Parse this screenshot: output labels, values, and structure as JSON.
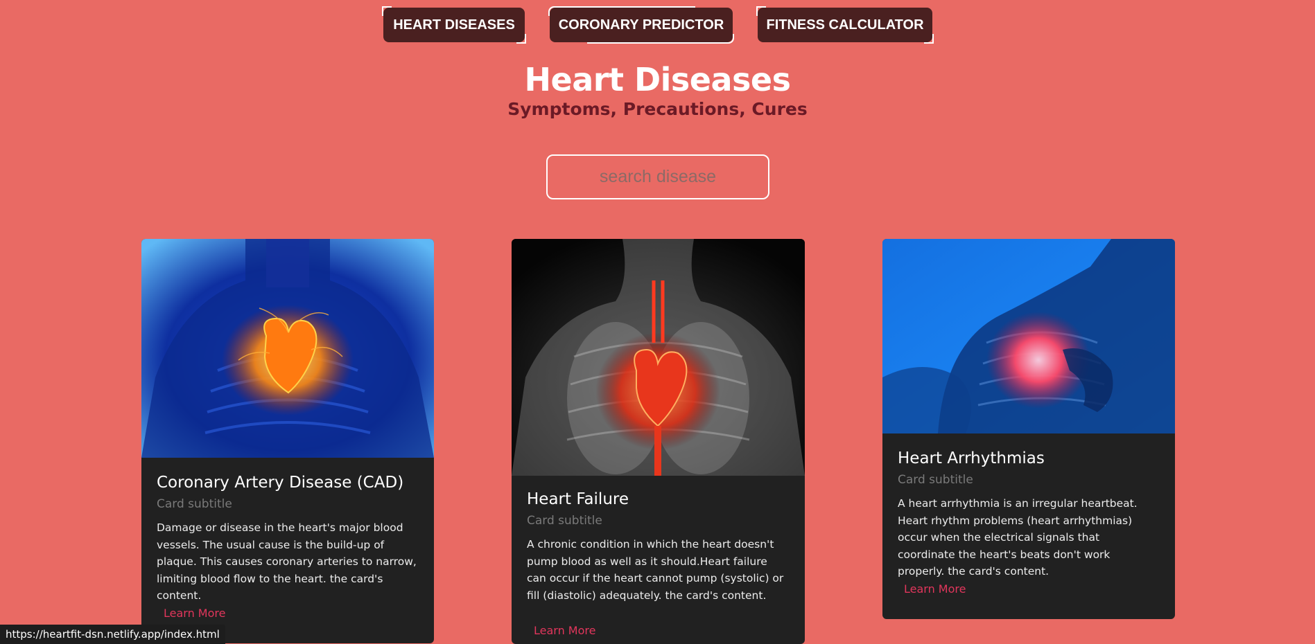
{
  "nav": {
    "items": [
      {
        "label": "HEART DISEASES"
      },
      {
        "label": "CORONARY PREDICTOR"
      },
      {
        "label": "FITNESS CALCULATOR"
      }
    ]
  },
  "header": {
    "title": "Heart Diseases",
    "subtitle": "Symptoms, Precautions, Cures"
  },
  "search": {
    "placeholder": "search disease",
    "value": ""
  },
  "cards": [
    {
      "title": "Coronary Artery Disease (CAD)",
      "subtitle": "Card subtitle",
      "text": "Damage or disease in the heart's major blood vessels. The usual cause is the build-up of plaque. This causes coronary arteries to narrow, limiting blood flow to the heart. the card's content.",
      "link": "Learn More",
      "image": "heart-xray-blue-image"
    },
    {
      "title": "Heart Failure",
      "subtitle": "Card subtitle",
      "text": "A chronic condition in which the heart doesn't pump blood as well as it should.Heart failure can occur if the heart cannot pump (systolic) or fill (diastolic) adequately. the card's content.",
      "link": "Learn More",
      "image": "heart-xray-grey-image"
    },
    {
      "title": "Heart Arrhythmias",
      "subtitle": "Card subtitle",
      "text": "A heart arrhythmia is an irregular heartbeat. Heart rhythm problems (heart arrhythmias) occur when the electrical signals that coordinate the heart's beats don't work properly. the card's content.",
      "link": "Learn More",
      "image": "chest-pain-xray-image"
    }
  ],
  "status": {
    "url": "https://heartfit-dsn.netlify.app/index.html"
  },
  "colors": {
    "background": "#e96a64",
    "nav_button": "#4a2020",
    "card": "#212121",
    "link": "#e2365c",
    "subtitle": "#6b1a26"
  }
}
